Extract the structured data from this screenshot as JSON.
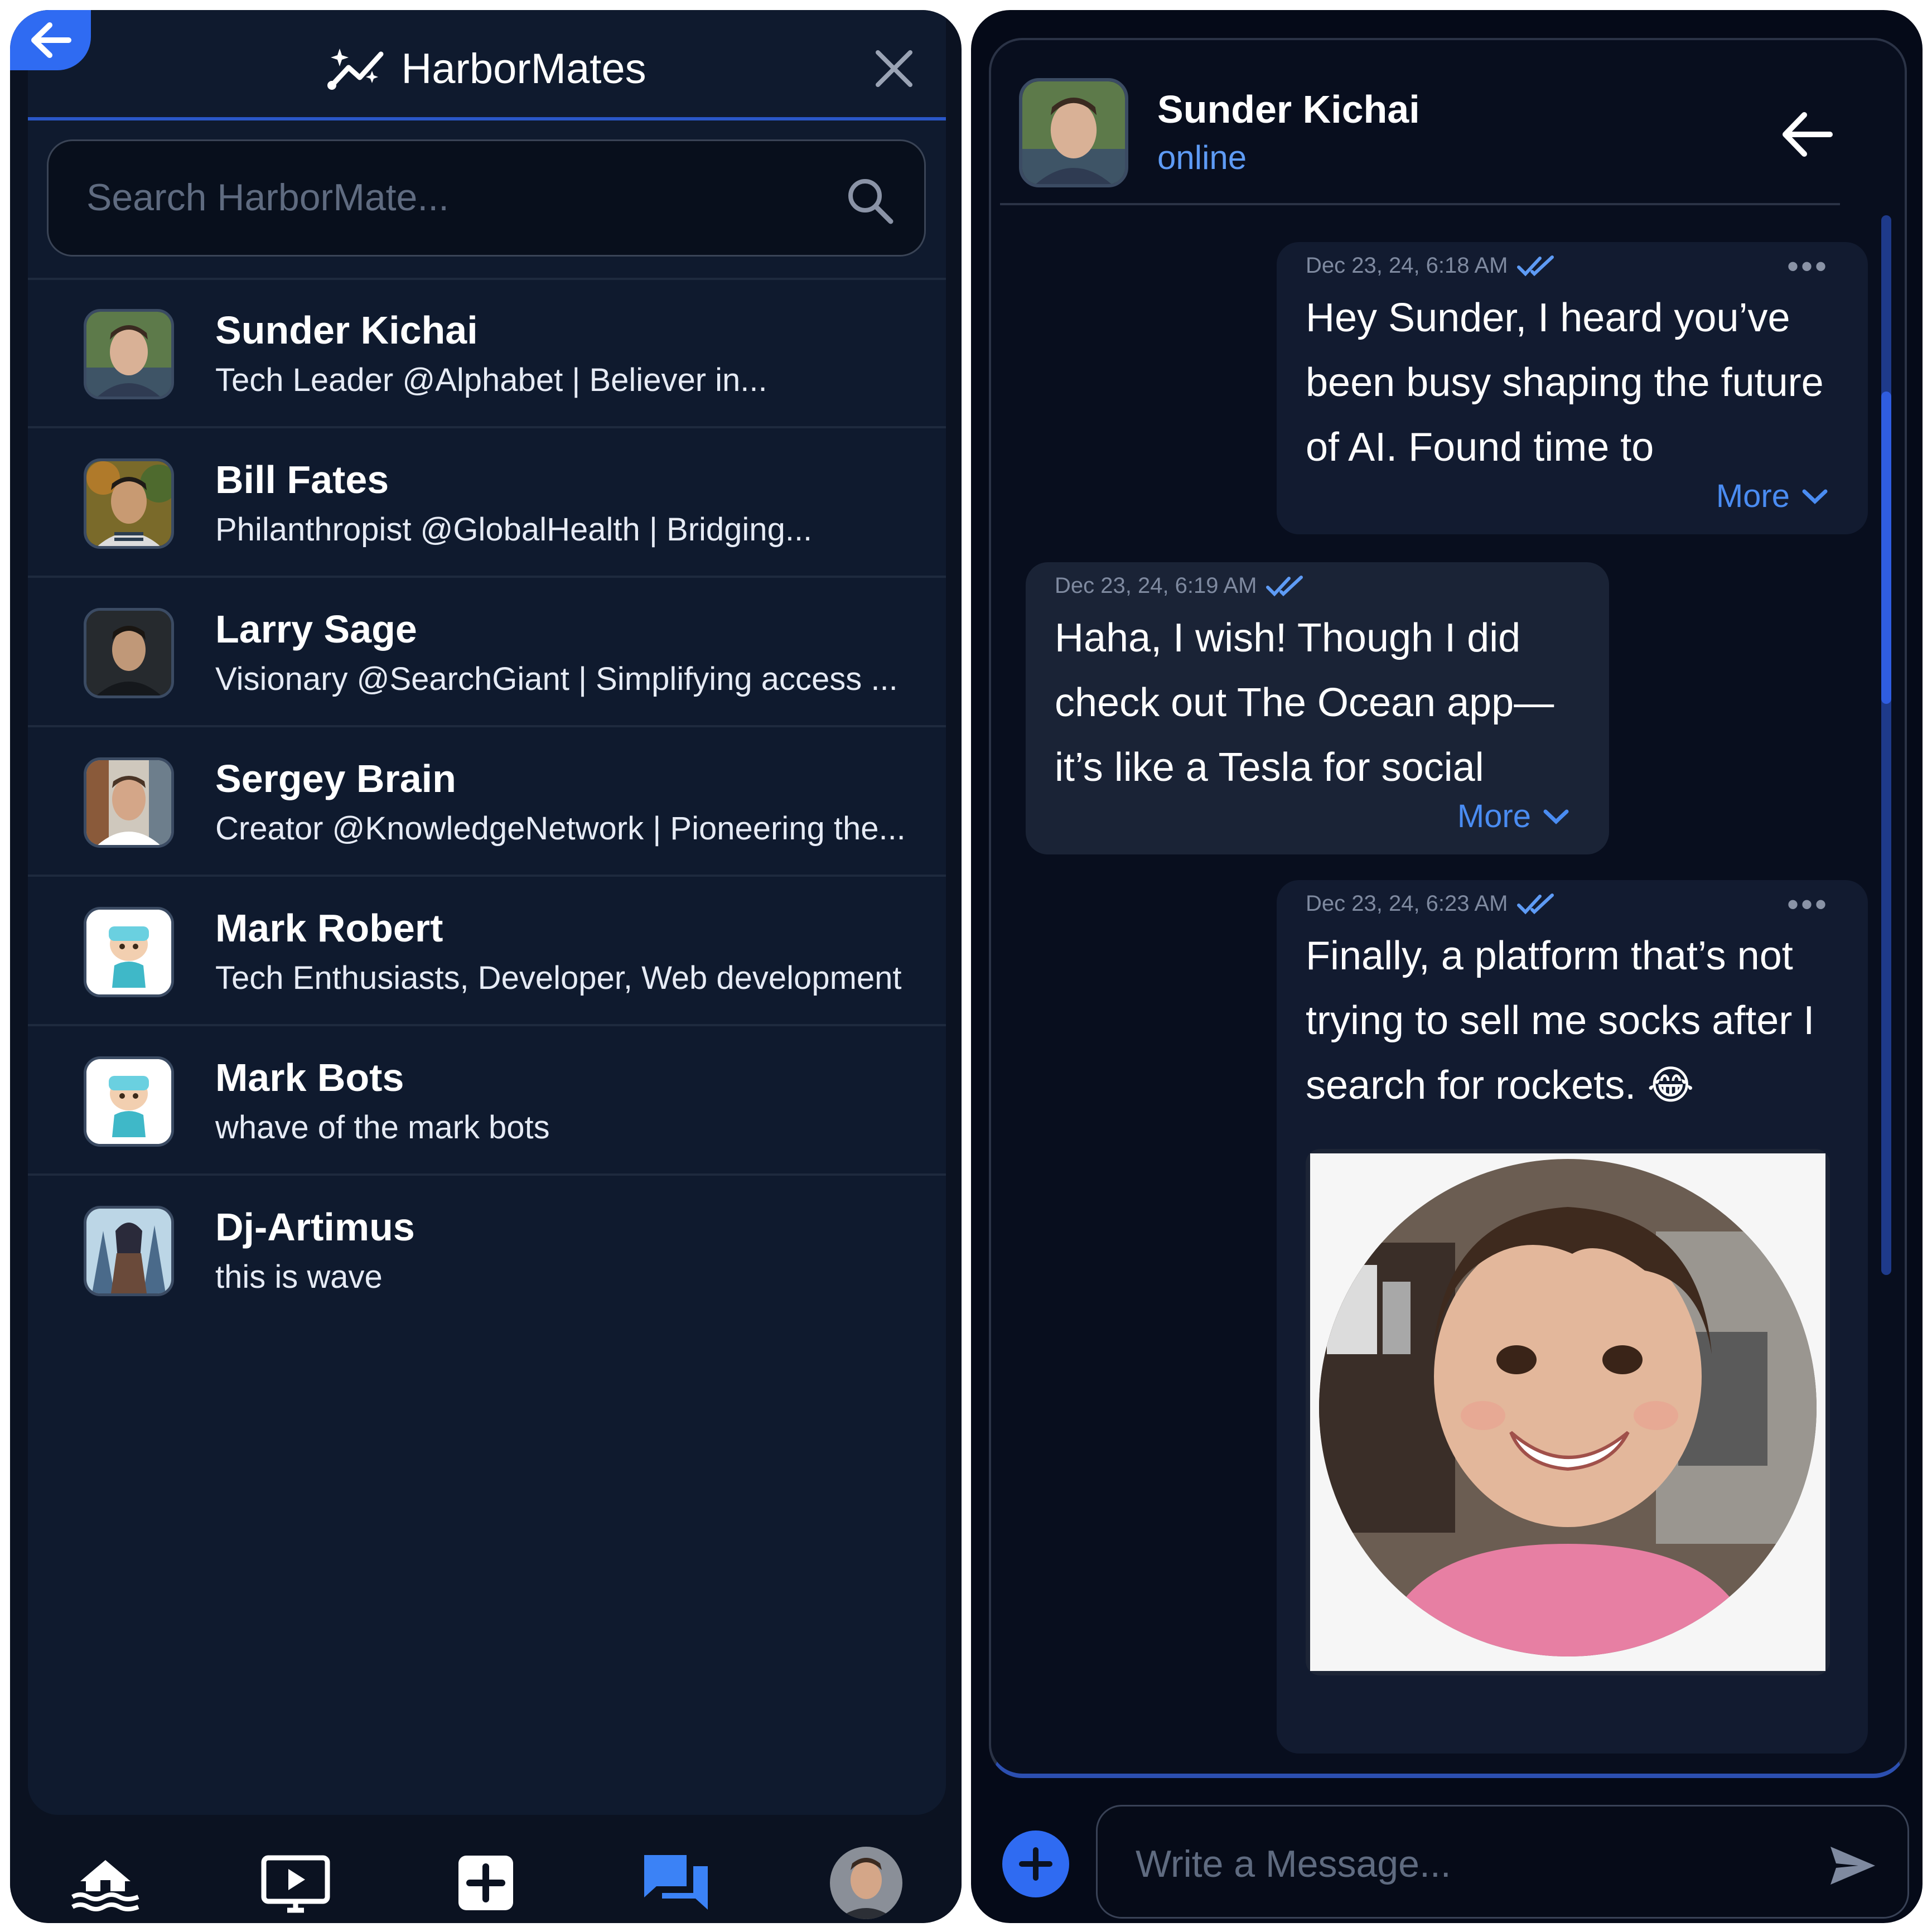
{
  "left": {
    "brand_title": "HarborMates",
    "search_placeholder": "Search HarborMate...",
    "contacts": [
      {
        "name": "Sunder Kichai",
        "bio": "Tech Leader @Alphabet | Believer in...",
        "avatar": "man-portrait"
      },
      {
        "name": "Bill Fates",
        "bio": "Philanthropist @GlobalHealth | Bridging...",
        "avatar": "man-portrait-outdoor"
      },
      {
        "name": "Larry Sage",
        "bio": "Visionary @SearchGiant | Simplifying access ...",
        "avatar": "man-portrait-dark"
      },
      {
        "name": "Sergey Brain",
        "bio": "Creator @KnowledgeNetwork | Pioneering the...",
        "avatar": "man-portrait-street"
      },
      {
        "name": "Mark Robert",
        "bio": "Tech Enthusiasts, Developer, Web development",
        "avatar": "cartoon-boy"
      },
      {
        "name": "Mark Bots",
        "bio": "whave of the mark bots",
        "avatar": "cartoon-boy"
      },
      {
        "name": "Dj-Artimus",
        "bio": "this is wave",
        "avatar": "fantasy-warrior"
      }
    ],
    "nav": [
      "home-boat-icon",
      "video-icon",
      "add-icon",
      "chat-icon",
      "profile-avatar"
    ]
  },
  "right": {
    "contact_name": "Sunder Kichai",
    "status": "online",
    "messages": [
      {
        "direction": "sent",
        "timestamp": "Dec 23, 24, 6:18 AM",
        "text": "Hey Sunder, I heard you’ve been busy shaping the future of AI. Found time to",
        "more": "More"
      },
      {
        "direction": "received",
        "timestamp": "Dec 23, 24, 6:19 AM",
        "text": "Haha, I wish! Though I did check out The Ocean app—it’s like a Tesla for social",
        "more": "More"
      },
      {
        "direction": "sent",
        "timestamp": "Dec 23, 24, 6:23 AM",
        "text": "Finally, a platform that’s not trying to sell me socks after I search for rockets. 😂",
        "attachment": "photo-smiling-child"
      }
    ],
    "composer_placeholder": "Write a Message..."
  },
  "colors": {
    "accent": "#2f6bf2",
    "link": "#4a8cf2",
    "status_online": "#5e9bf5",
    "panel_bg": "#0f1a2e"
  }
}
